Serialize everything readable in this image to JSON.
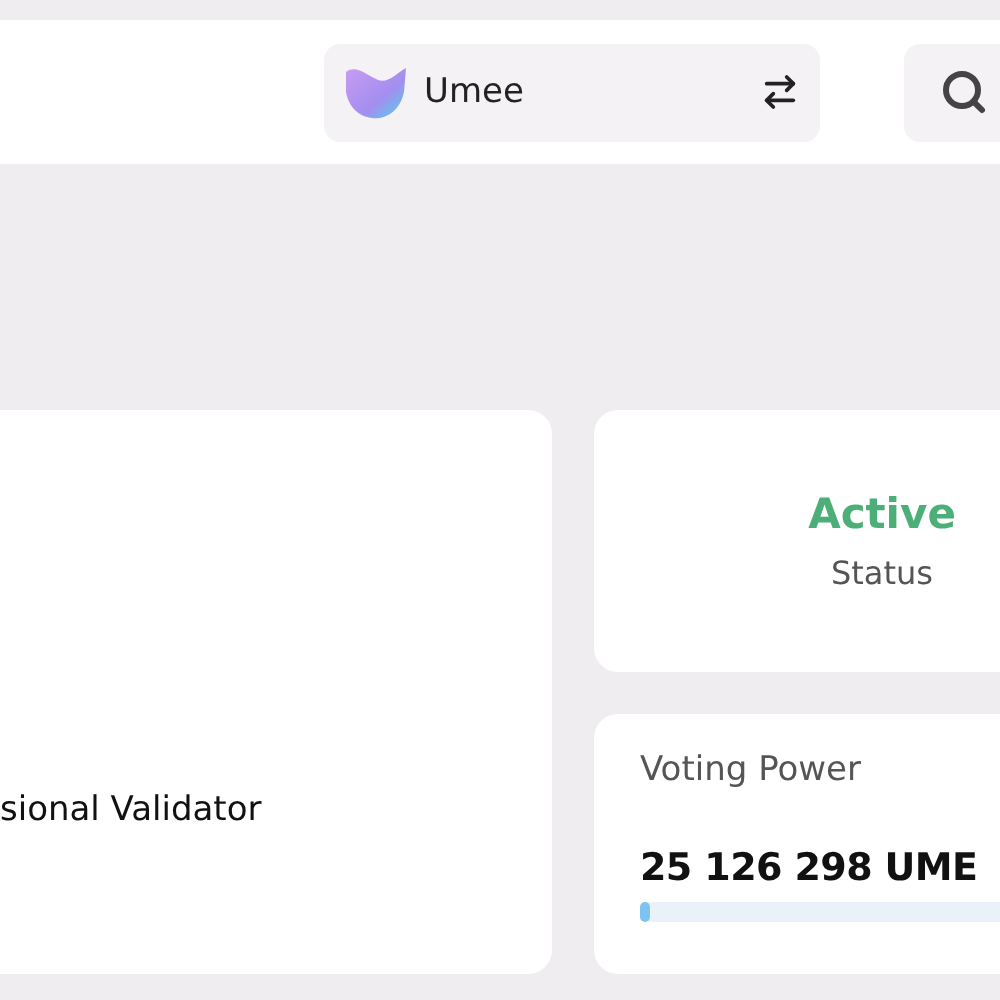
{
  "header": {
    "chain_selector": {
      "name": "Umee"
    }
  },
  "validator": {
    "description": "sional Validator"
  },
  "status_card": {
    "value": "Active",
    "label": "Status"
  },
  "voting_power": {
    "label": "Voting Power",
    "amount": "25 126 298 UME",
    "level": 0.02
  }
}
